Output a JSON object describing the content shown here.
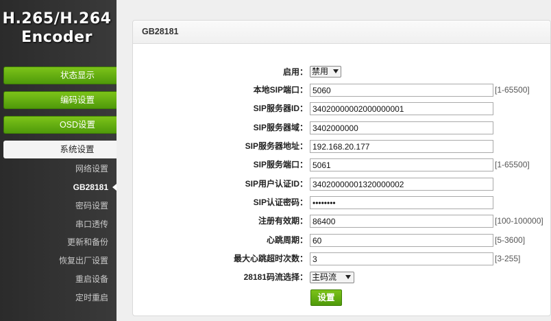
{
  "brand": {
    "line1": "H.265/H.264",
    "line2": "Encoder"
  },
  "nav": {
    "status": "状态显示",
    "encode": "编码设置",
    "osd": "OSD设置",
    "system": "系统设置",
    "sub": [
      "网络设置",
      "GB28181",
      "密码设置",
      "串口透传",
      "更新和备份",
      "恢复出厂设置",
      "重启设备",
      "定时重启"
    ]
  },
  "panel": {
    "title": "GB28181",
    "enable": {
      "label": "启用：",
      "value": "禁用"
    },
    "local_sip_port": {
      "label": "本地SIP端口：",
      "value": "5060",
      "range": "[1-65500]"
    },
    "sip_server_id": {
      "label": "SIP服务器ID：",
      "value": "34020000002000000001"
    },
    "sip_server_domain": {
      "label": "SIP服务器域：",
      "value": "3402000000"
    },
    "sip_server_addr": {
      "label": "SIP服务器地址：",
      "value": "192.168.20.177"
    },
    "sip_server_port": {
      "label": "SIP服务端口：",
      "value": "5061",
      "range": "[1-65500]"
    },
    "sip_user_id": {
      "label": "SIP用户认证ID：",
      "value": "34020000001320000002"
    },
    "sip_password": {
      "label": "SIP认证密码：",
      "value": "••••••••"
    },
    "register_expiry": {
      "label": "注册有效期：",
      "value": "86400",
      "range": "[100-100000]"
    },
    "heartbeat": {
      "label": "心跳周期：",
      "value": "60",
      "range": "[5-3600]"
    },
    "max_heartbeat_timeout": {
      "label": "最大心跳超时次数：",
      "value": "3",
      "range": "[3-255]"
    },
    "stream_select": {
      "label": "28181码流选择：",
      "value": "主码流"
    },
    "set_button": "设置"
  }
}
